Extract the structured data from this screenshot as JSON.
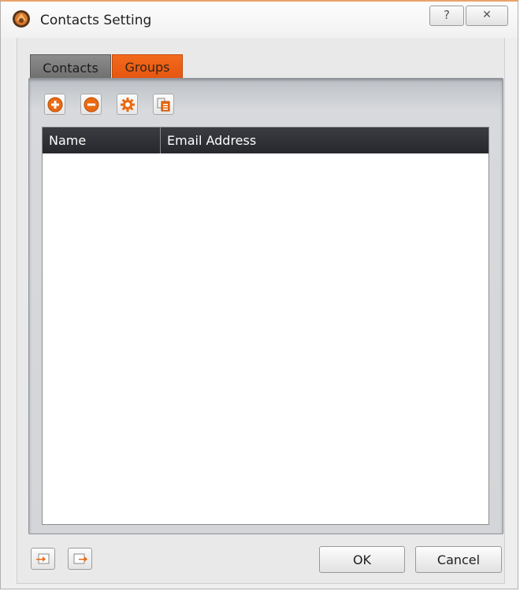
{
  "window": {
    "title": "Contacts Setting",
    "help_label": "?",
    "close_label": "✕",
    "accent_color": "#e55510"
  },
  "tabs": [
    {
      "label": "Contacts",
      "active": false
    },
    {
      "label": "Groups",
      "active": true
    }
  ],
  "toolbar": {
    "buttons": [
      {
        "icon": "add-circle-icon"
      },
      {
        "icon": "remove-circle-icon"
      },
      {
        "icon": "gear-icon"
      },
      {
        "icon": "copy-icon"
      }
    ]
  },
  "list": {
    "columns": [
      "Name",
      "Email Address"
    ],
    "rows": []
  },
  "footer": {
    "import_icon": "import-icon",
    "export_icon": "export-icon",
    "ok_label": "OK",
    "cancel_label": "Cancel"
  }
}
